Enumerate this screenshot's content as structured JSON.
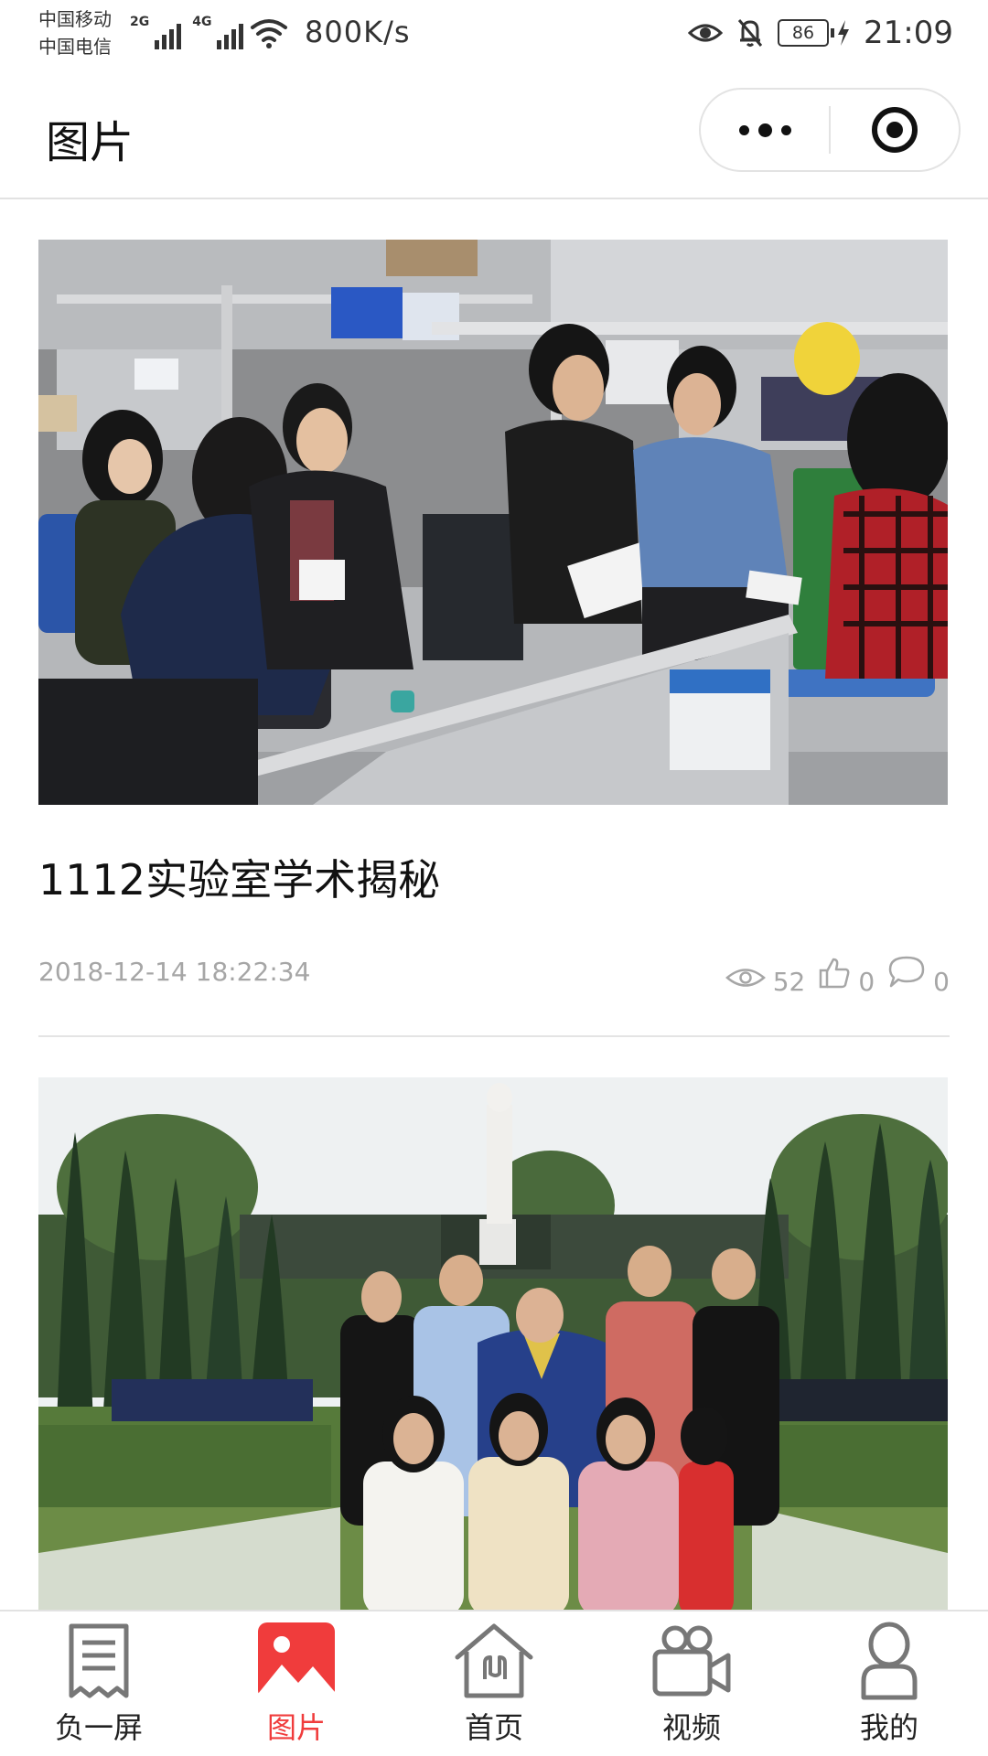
{
  "status_bar": {
    "carrier1": "中国移动",
    "carrier2": "中国电信",
    "net1": "2G",
    "net2": "4G",
    "speed": "800K/s",
    "battery": "86",
    "time": "21:09"
  },
  "header": {
    "title": "图片"
  },
  "posts": [
    {
      "title": "1112实验室学术揭秘",
      "date": "2018-12-14 18:22:34",
      "views": "52",
      "likes": "0",
      "comments": "0"
    },
    {
      "title": "",
      "date": "",
      "views": "",
      "likes": "",
      "comments": ""
    }
  ],
  "tab_bar": {
    "items": [
      {
        "label": "负一屏",
        "icon": "news-icon"
      },
      {
        "label": "图片",
        "icon": "image-icon"
      },
      {
        "label": "首页",
        "icon": "home-icon"
      },
      {
        "label": "视频",
        "icon": "video-icon"
      },
      {
        "label": "我的",
        "icon": "user-icon"
      }
    ],
    "active_index": 1
  },
  "colors": {
    "accent": "#f03c3c",
    "meta_text": "#a6a6a6",
    "divider": "#e4e4e4"
  }
}
